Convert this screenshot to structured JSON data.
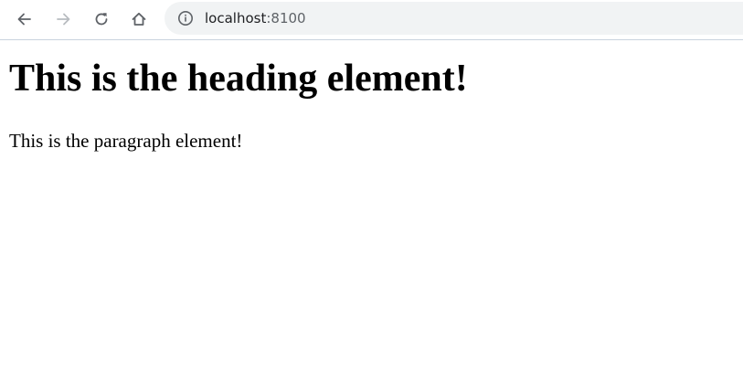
{
  "browser": {
    "toolbar": {
      "back_icon": "arrow-left-icon",
      "forward_icon": "arrow-right-icon",
      "reload_icon": "reload-icon",
      "home_icon": "home-icon"
    },
    "omnibox": {
      "info_icon": "info-icon",
      "host": "localhost",
      "port": ":8100"
    }
  },
  "page": {
    "heading": "This is the heading element!",
    "paragraph": "This is the paragraph element!"
  },
  "colors": {
    "toolbar_icon": "#5f6368",
    "toolbar_icon_disabled": "#b8bcc0",
    "omnibox_bg": "#f1f3f4",
    "text": "#000000"
  }
}
